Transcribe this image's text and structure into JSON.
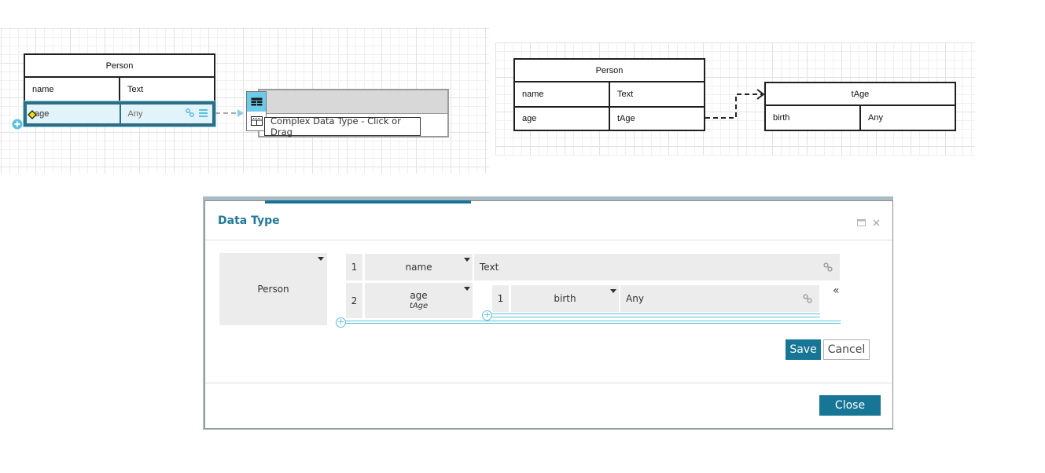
{
  "canvas_left": {
    "entity": {
      "title": "Person",
      "rows": [
        {
          "name": "name",
          "type": "Text"
        },
        {
          "name": "age",
          "type": "Any"
        }
      ]
    },
    "tooltip": "Complex Data Type - Click or Drag",
    "icons": {
      "row_link": "link-icon",
      "row_menu": "menu-icon",
      "add": "plus-circle-icon",
      "edit": "diamond-handle-icon",
      "complex_type": "table-icon",
      "simple_type": "table-alt-icon"
    }
  },
  "canvas_right": {
    "person": {
      "title": "Person",
      "rows": [
        {
          "name": "name",
          "type": "Text"
        },
        {
          "name": "age",
          "type": "tAge"
        }
      ]
    },
    "tage": {
      "title": "tAge",
      "rows": [
        {
          "name": "birth",
          "type": "Any"
        }
      ]
    }
  },
  "dialog": {
    "title": "Data Type",
    "maximize_icon": "maximize-icon",
    "close_icon": "close-icon",
    "type_name": "Person",
    "fields": [
      {
        "index": "1",
        "name": "name",
        "type": "Text"
      },
      {
        "index": "2",
        "name": "age",
        "subtype": "tAge",
        "children": [
          {
            "index": "1",
            "name": "birth",
            "type": "Any"
          }
        ]
      }
    ],
    "collapse_glyph": "«",
    "add_glyph": "+",
    "save_label": "Save",
    "cancel_label": "Cancel",
    "close_label": "Close"
  }
}
